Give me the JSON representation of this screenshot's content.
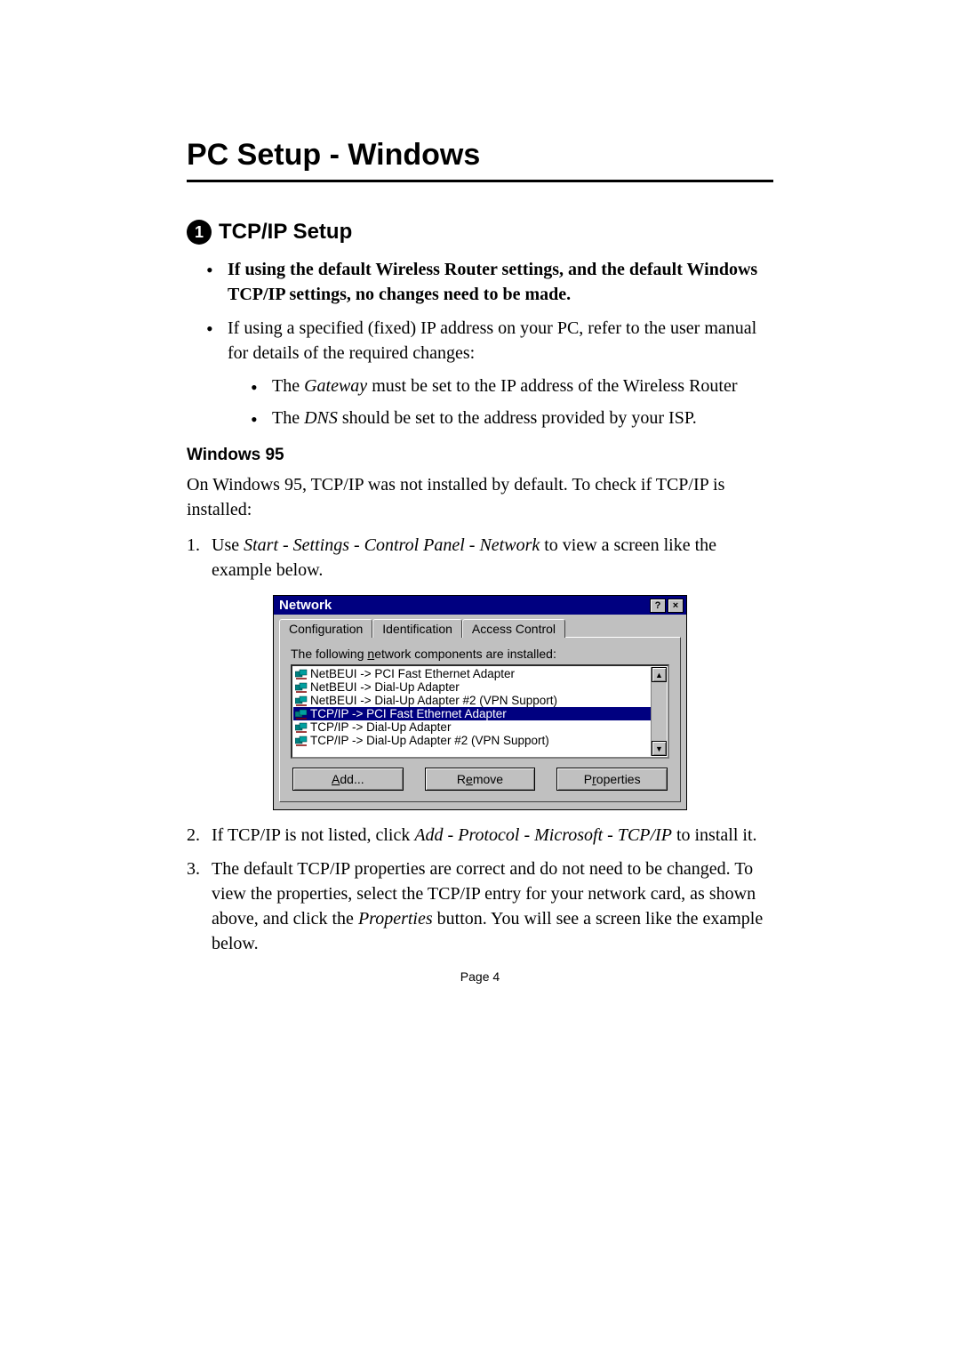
{
  "heading1": "PC Setup - Windows",
  "section": {
    "number": "1",
    "title": "TCP/IP Setup"
  },
  "bullets_main": [
    {
      "html": "<span class='bold'>If using the default Wireless Router settings, and the default Windows TCP/IP settings, no changes need to be made.</span>"
    },
    {
      "html": "If using a specified (fixed) IP address on your PC, refer to the user manual for details of the required changes:"
    }
  ],
  "bullets_sub": [
    {
      "html": "The <span class='italic'>Gateway</span> must be set to the IP address of the Wireless Router"
    },
    {
      "html": "The <span class='italic'>DNS</span> should be set to the address provided by your ISP."
    }
  ],
  "win95_head": "Windows 95",
  "win95_para": "On Windows 95, TCP/IP was not installed by default. To check if TCP/IP is installed:",
  "steps1": [
    {
      "html": "Use <span class='italic'>Start - Settings - Control Panel - Network</span> to view a screen like the example below."
    }
  ],
  "dialog": {
    "title": "Network",
    "tabs": [
      "Configuration",
      "Identification",
      "Access Control"
    ],
    "label_html": "The following <span class='ul'>n</span>etwork components are installed:",
    "items": [
      {
        "text": "NetBEUI -> PCI Fast Ethernet Adapter",
        "sel": false
      },
      {
        "text": "NetBEUI -> Dial-Up Adapter",
        "sel": false
      },
      {
        "text": "NetBEUI -> Dial-Up Adapter #2 (VPN Support)",
        "sel": false
      },
      {
        "text": "TCP/IP -> PCI Fast Ethernet Adapter",
        "sel": true
      },
      {
        "text": "TCP/IP -> Dial-Up Adapter",
        "sel": false
      },
      {
        "text": "TCP/IP -> Dial-Up Adapter #2 (VPN Support)",
        "sel": false
      }
    ],
    "buttons": {
      "add_html": "<span class='ul'>A</span>dd...",
      "remove_html": "R<span class='ul'>e</span>move",
      "properties_html": "P<span class='ul'>r</span>operties"
    }
  },
  "steps2": [
    {
      "html": "If TCP/IP is not listed, click <span class='italic'>Add - Protocol - Microsoft - TCP/IP</span> to install it."
    },
    {
      "html": "The default TCP/IP properties are correct and do not need to be changed. To view the properties, select the TCP/IP entry for your network card, as shown above, and click the <span class='italic'>Properties</span> button. You will see a screen like the example below."
    }
  ],
  "page_label": "Page ",
  "page_num": "4"
}
